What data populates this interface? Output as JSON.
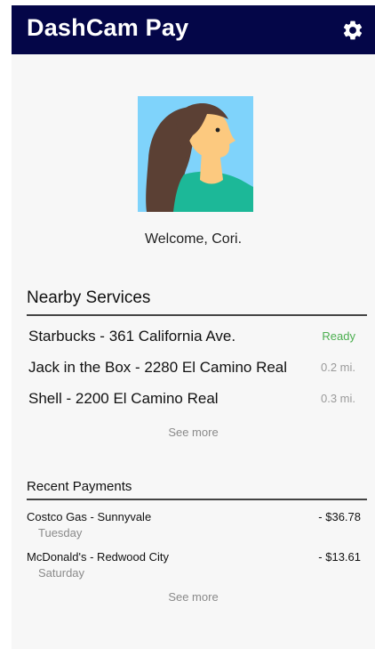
{
  "app": {
    "title": "DashCam Pay"
  },
  "user": {
    "welcome": "Welcome, Cori."
  },
  "nearby": {
    "title": "Nearby Services",
    "items": [
      {
        "name": "Starbucks - 361 California Ave.",
        "status": "Ready"
      },
      {
        "name": "Jack in the Box - 2280 El Camino Real",
        "status": "0.2 mi."
      },
      {
        "name": "Shell - 2200 El Camino Real",
        "status": "0.3 mi."
      }
    ],
    "see_more": "See more"
  },
  "payments": {
    "title": "Recent Payments",
    "items": [
      {
        "name": "Costco Gas - Sunnyvale",
        "day": "Tuesday",
        "amount": "- $36.78"
      },
      {
        "name": "McDonald's - Redwood City",
        "day": "Saturday",
        "amount": "- $13.61"
      }
    ],
    "see_more": "See more"
  },
  "colors": {
    "appbar": "#040648",
    "ready": "#4caf50",
    "avatar_bg": "#7fd3fb",
    "hair": "#5b4034",
    "skin": "#fcc97f",
    "shirt": "#1cb898"
  },
  "icons": {
    "settings": "gear-icon",
    "avatar": "avatar-illustration"
  }
}
